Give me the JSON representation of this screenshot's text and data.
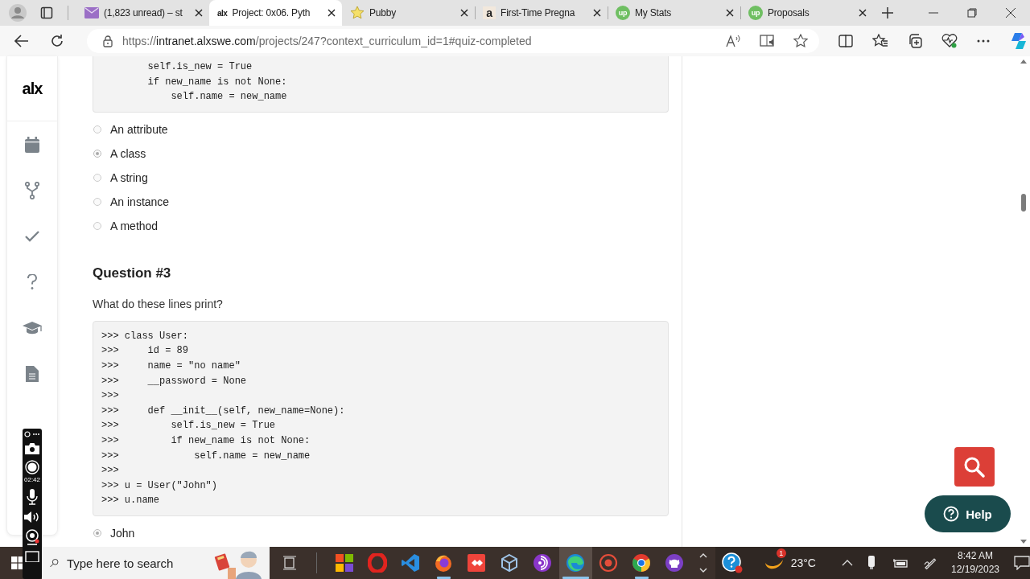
{
  "browser": {
    "tabs": [
      {
        "kind": "mail",
        "title": "(1,823 unread) – st",
        "selected": false
      },
      {
        "kind": "alx",
        "icon_text": "alx",
        "title": "Project: 0x06. Pyth",
        "selected": true
      },
      {
        "kind": "star",
        "title": "Pubby",
        "selected": false
      },
      {
        "kind": "amazon",
        "icon_text": "a",
        "title": "First-Time Pregna",
        "selected": false
      },
      {
        "kind": "upwork",
        "icon_text": "up",
        "title": "My Stats",
        "selected": false
      },
      {
        "kind": "upwork",
        "icon_text": "up",
        "title": "Proposals",
        "selected": false
      }
    ],
    "url": {
      "scheme": "https://",
      "host": "intranet.alxswe.com",
      "path": "/projects/247?context_curriculum_id=1#quiz-completed"
    }
  },
  "sidebar": {
    "logo": "alx",
    "items": [
      {
        "kind": "calendar"
      },
      {
        "kind": "fork"
      },
      {
        "kind": "check"
      },
      {
        "kind": "question"
      },
      {
        "kind": "cap"
      },
      {
        "kind": "document"
      }
    ]
  },
  "quiz": {
    "previous": {
      "code": [
        "        self.is_new = True",
        "        if new_name is not None:",
        "            self.name = new_name"
      ],
      "options": [
        {
          "label": "An attribute",
          "selected": false
        },
        {
          "label": "A class",
          "selected": true
        },
        {
          "label": "A string",
          "selected": false
        },
        {
          "label": "An instance",
          "selected": false
        },
        {
          "label": "A method",
          "selected": false
        }
      ]
    },
    "question": {
      "title": "Question #3",
      "prompt": "What do these lines print?",
      "code": [
        ">>> class User:",
        ">>>     id = 89",
        ">>>     name = \"no name\"",
        ">>>     __password = None",
        ">>>",
        ">>>     def __init__(self, new_name=None):",
        ">>>         self.is_new = True",
        ">>>         if new_name is not None:",
        ">>>             self.name = new_name",
        ">>>",
        ">>> u = User(\"John\")",
        ">>> u.name"
      ],
      "options": [
        {
          "label": "John",
          "selected": true
        }
      ]
    }
  },
  "help_button": {
    "label": "Help"
  },
  "recorder": {
    "timer": "02:42"
  },
  "taskbar": {
    "search": {
      "placeholder": "Type here to search"
    },
    "apps": [
      {
        "kind": "store",
        "running": false,
        "selected": false
      },
      {
        "kind": "opera",
        "running": false,
        "selected": false
      },
      {
        "kind": "vscode",
        "running": false,
        "selected": false
      },
      {
        "kind": "firefox",
        "running": true,
        "selected": false
      },
      {
        "kind": "anydesk",
        "running": false,
        "selected": false
      },
      {
        "kind": "cube",
        "running": false,
        "selected": false
      },
      {
        "kind": "podcast",
        "running": false,
        "selected": false
      },
      {
        "kind": "edge",
        "running": true,
        "selected": true
      },
      {
        "kind": "record",
        "running": false,
        "selected": false
      },
      {
        "kind": "chrome",
        "running": true,
        "selected": false
      },
      {
        "kind": "github",
        "running": false,
        "selected": false
      }
    ],
    "weather": {
      "badge": "1",
      "temperature": "23°C"
    },
    "clock": {
      "time": "8:42 AM",
      "date": "12/19/2023"
    }
  }
}
